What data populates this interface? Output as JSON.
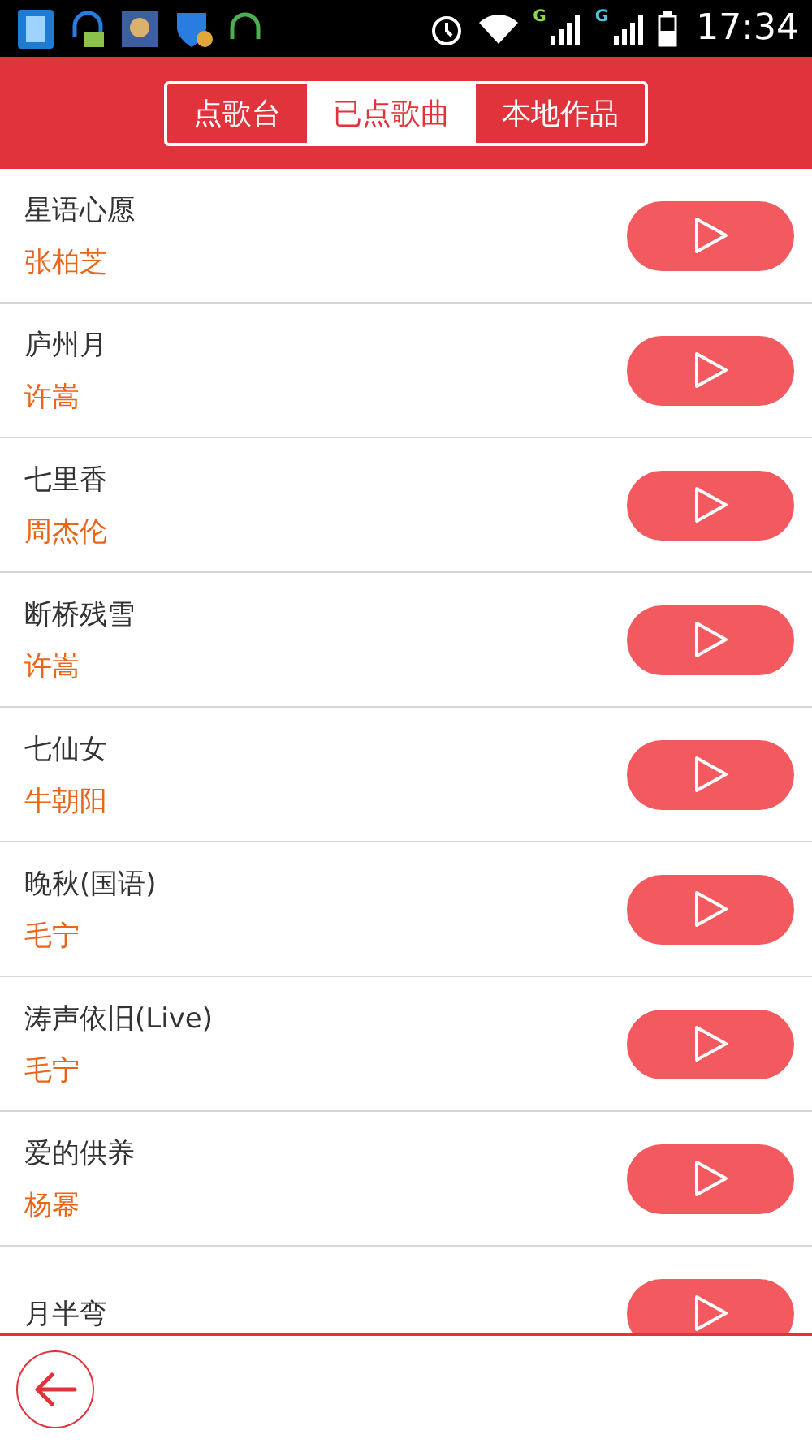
{
  "status_bar": {
    "time": "17:34",
    "signal_labels": [
      "G",
      "G"
    ]
  },
  "tabs": [
    {
      "label": "点歌台",
      "selected": false
    },
    {
      "label": "已点歌曲",
      "selected": true
    },
    {
      "label": "本地作品",
      "selected": false
    }
  ],
  "songs": [
    {
      "title": "星语心愿",
      "artist": "张柏芝"
    },
    {
      "title": "庐州月",
      "artist": "许嵩"
    },
    {
      "title": "七里香",
      "artist": "周杰伦"
    },
    {
      "title": "断桥残雪",
      "artist": "许嵩"
    },
    {
      "title": "七仙女",
      "artist": "牛朝阳"
    },
    {
      "title": "晚秋(国语)",
      "artist": "毛宁"
    },
    {
      "title": "涛声依旧(Live)",
      "artist": "毛宁"
    },
    {
      "title": "爱的供养",
      "artist": "杨幂"
    },
    {
      "title": "月半弯"
    }
  ]
}
